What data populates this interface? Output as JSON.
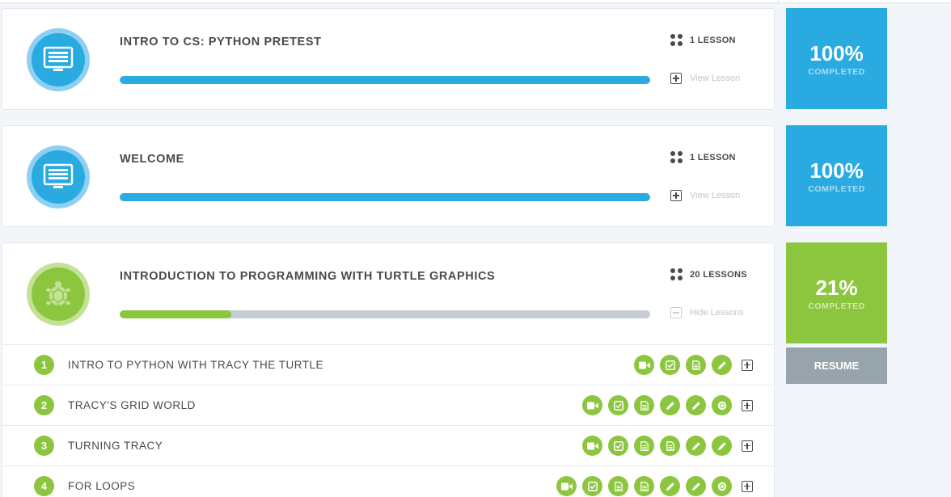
{
  "modules": [
    {
      "title": "INTRO TO CS: PYTHON PRETEST",
      "lesson_count": "1 LESSON",
      "toggle_label": "View Lesson",
      "progress": 1.0,
      "status_percent": "100%",
      "status_label": "COMPLETED",
      "icon": "monitor-icon",
      "color": "#29abe2"
    },
    {
      "title": "WELCOME",
      "lesson_count": "1 LESSON",
      "toggle_label": "View Lesson",
      "progress": 1.0,
      "status_percent": "100%",
      "status_label": "COMPLETED",
      "icon": "monitor-icon",
      "color": "#29abe2"
    },
    {
      "title": "INTRODUCTION TO PROGRAMMING WITH TURTLE GRAPHICS",
      "lesson_count": "20 LESSONS",
      "toggle_label": "Hide Lessons",
      "progress": 0.21,
      "status_percent": "21%",
      "status_label": "COMPLETED",
      "icon": "turtle-icon",
      "color": "#8cc63f",
      "resume_label": "RESUME",
      "lessons": [
        {
          "number": "1",
          "title": "INTRO TO PYTHON WITH TRACY THE TURTLE",
          "activities": [
            "video-icon",
            "quiz-check-icon",
            "document-icon",
            "pencil-icon"
          ]
        },
        {
          "number": "2",
          "title": "TRACY'S GRID WORLD",
          "activities": [
            "video-icon",
            "quiz-check-icon",
            "document-icon",
            "pencil-icon",
            "pencil-icon",
            "badge-icon"
          ]
        },
        {
          "number": "3",
          "title": "TURNING TRACY",
          "activities": [
            "video-icon",
            "quiz-check-icon",
            "document-icon",
            "document-icon",
            "pencil-icon",
            "pencil-icon"
          ]
        },
        {
          "number": "4",
          "title": "FOR LOOPS",
          "activities": [
            "video-icon",
            "quiz-check-icon",
            "document-icon",
            "document-icon",
            "pencil-icon",
            "pencil-icon",
            "badge-icon"
          ]
        }
      ]
    }
  ],
  "colors": {
    "blue": "#29abe2",
    "green": "#8cc63f",
    "resume_gray": "#97a4ab",
    "track_gray": "#c4cdd3"
  }
}
